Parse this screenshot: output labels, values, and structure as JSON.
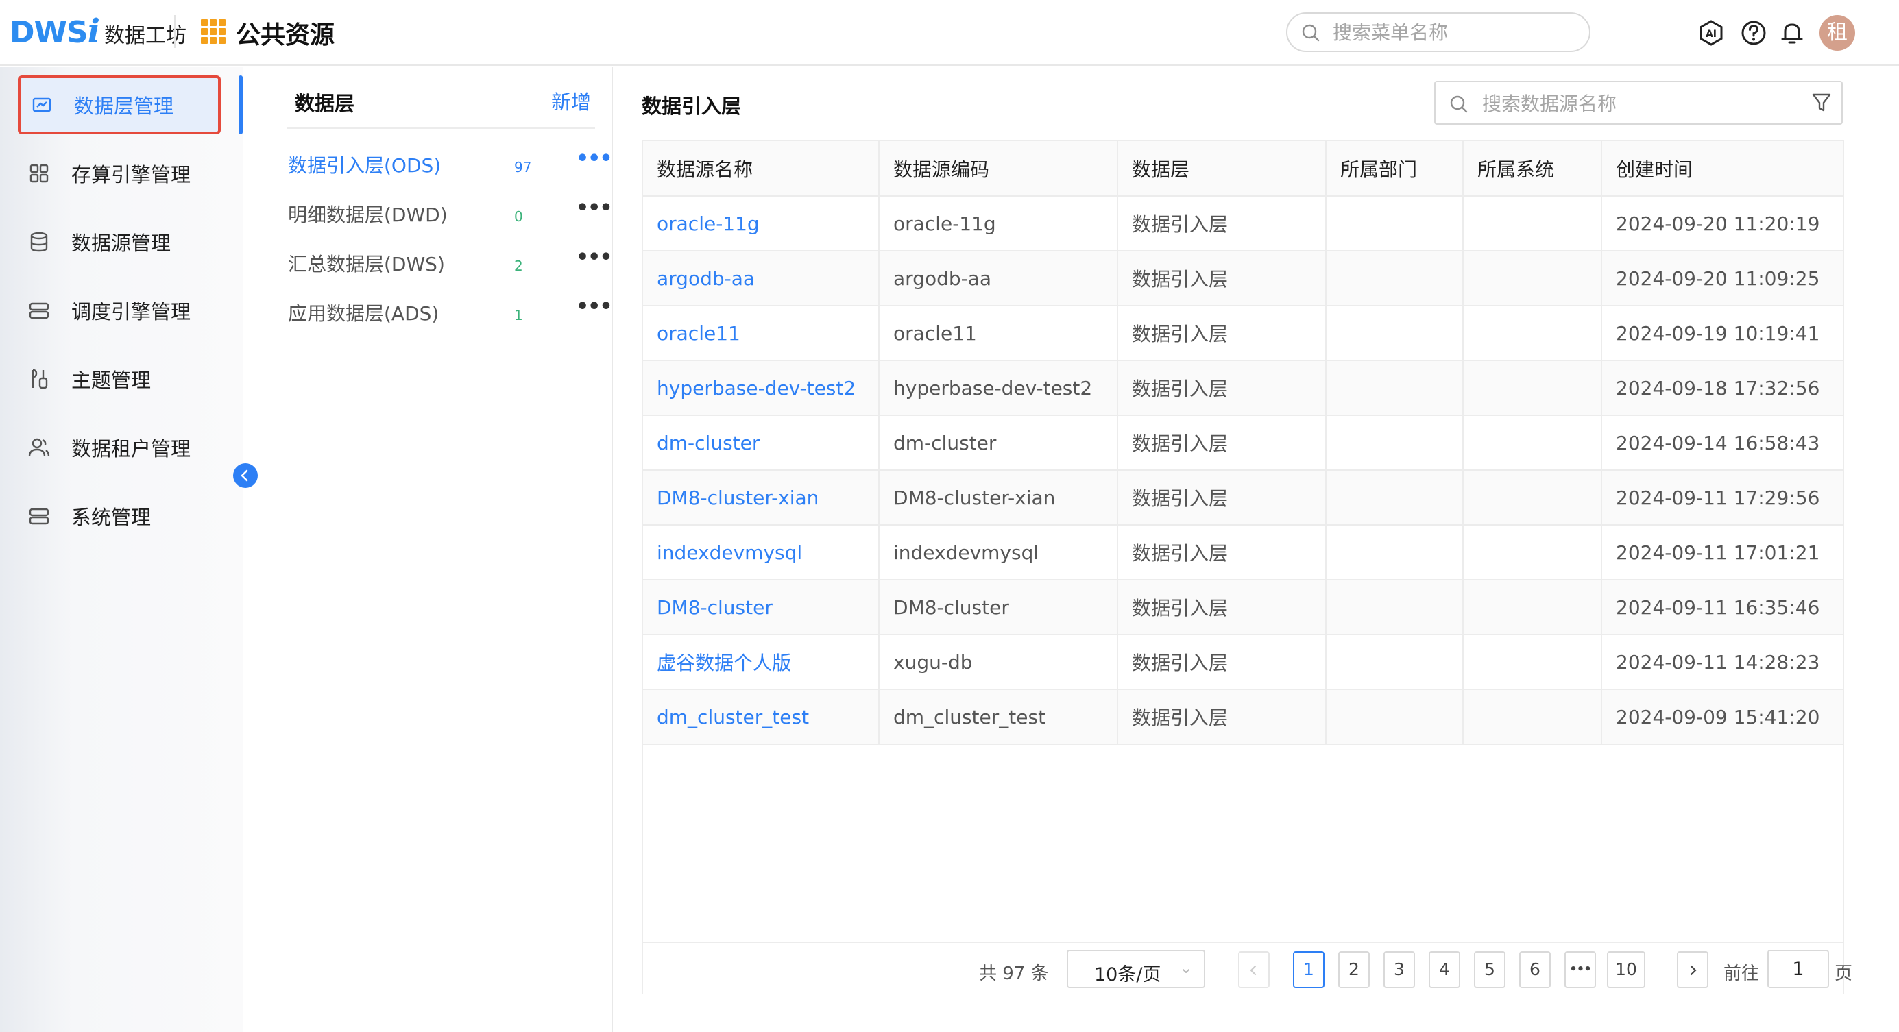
{
  "header": {
    "logo_main": "DWS",
    "logo_i": "i",
    "logo_sub": "数据工坊",
    "app_title": "公共资源",
    "search_placeholder": "搜索菜单名称",
    "avatar_text": "租",
    "icons": [
      "ai-icon",
      "help-icon",
      "bell-icon"
    ]
  },
  "sidebar": {
    "items": [
      {
        "label": "数据层管理",
        "icon": "layer-icon",
        "active": true
      },
      {
        "label": "存算引擎管理",
        "icon": "engine-icon"
      },
      {
        "label": "数据源管理",
        "icon": "database-icon"
      },
      {
        "label": "调度引擎管理",
        "icon": "schedule-icon"
      },
      {
        "label": "主题管理",
        "icon": "theme-icon"
      },
      {
        "label": "数据租户管理",
        "icon": "tenant-icon"
      },
      {
        "label": "系统管理",
        "icon": "system-icon"
      }
    ]
  },
  "layers": {
    "title": "数据层",
    "add_label": "新增",
    "items": [
      {
        "name": "数据引入层(ODS)",
        "count": "97",
        "active": true
      },
      {
        "name": "明细数据层(DWD)",
        "count": "0"
      },
      {
        "name": "汇总数据层(DWS)",
        "count": "2"
      },
      {
        "name": "应用数据层(ADS)",
        "count": "1"
      }
    ]
  },
  "main": {
    "title": "数据引入层",
    "search_placeholder": "搜索数据源名称",
    "columns": [
      "数据源名称",
      "数据源编码",
      "数据层",
      "所属部门",
      "所属系统",
      "创建时间"
    ],
    "rows": [
      [
        "oracle-11g",
        "oracle-11g",
        "数据引入层",
        "",
        "",
        "2024-09-20 11:20:19"
      ],
      [
        "argodb-aa",
        "argodb-aa",
        "数据引入层",
        "",
        "",
        "2024-09-20 11:09:25"
      ],
      [
        "oracle11",
        "oracle11",
        "数据引入层",
        "",
        "",
        "2024-09-19 10:19:41"
      ],
      [
        "hyperbase-dev-test2",
        "hyperbase-dev-test2",
        "数据引入层",
        "",
        "",
        "2024-09-18 17:32:56"
      ],
      [
        "dm-cluster",
        "dm-cluster",
        "数据引入层",
        "",
        "",
        "2024-09-14 16:58:43"
      ],
      [
        "DM8-cluster-xian",
        "DM8-cluster-xian",
        "数据引入层",
        "",
        "",
        "2024-09-11 17:29:56"
      ],
      [
        "indexdevmysql",
        "indexdevmysql",
        "数据引入层",
        "",
        "",
        "2024-09-11 17:01:21"
      ],
      [
        "DM8-cluster",
        "DM8-cluster",
        "数据引入层",
        "",
        "",
        "2024-09-11 16:35:46"
      ],
      [
        "虚谷数据个人版",
        "xugu-db",
        "数据引入层",
        "",
        "",
        "2024-09-11 14:28:23"
      ],
      [
        "dm_cluster_test",
        "dm_cluster_test",
        "数据引入层",
        "",
        "",
        "2024-09-09 15:41:20"
      ]
    ]
  },
  "pagination": {
    "total_text": "共 97 条",
    "page_size": "10条/页",
    "pages": [
      "1",
      "2",
      "3",
      "4",
      "5",
      "6",
      "•••",
      "10"
    ],
    "current_page": "1",
    "goto_label": "前往",
    "goto_value": "1",
    "page_suffix": "页"
  },
  "colors": {
    "accent": "#2d7ff5",
    "highlight_border": "#e54a3c",
    "count_green": "#3bb27a"
  }
}
